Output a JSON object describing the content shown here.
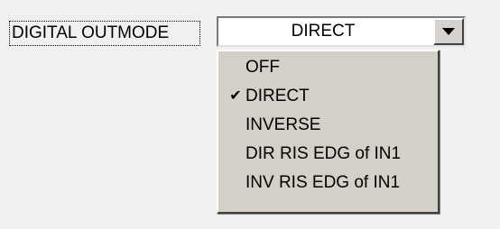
{
  "field": {
    "label": "DIGITAL OUTMODE",
    "selected_value": "DIRECT"
  },
  "dropdown": {
    "items": [
      {
        "label": "OFF",
        "checked": false
      },
      {
        "label": "DIRECT",
        "checked": true
      },
      {
        "label": "INVERSE",
        "checked": false
      },
      {
        "label": "DIR RIS EDG of IN1",
        "checked": false
      },
      {
        "label": "INV RIS EDG of IN1",
        "checked": false
      }
    ],
    "check_mark": "✔"
  },
  "icons": {
    "combo_arrow": "chevron-down-icon",
    "check": "checkmark-icon"
  },
  "colors": {
    "panel_background": "#f0f0f0",
    "dropdown_background": "#d4d0c8",
    "combo_background": "#ffffff"
  }
}
